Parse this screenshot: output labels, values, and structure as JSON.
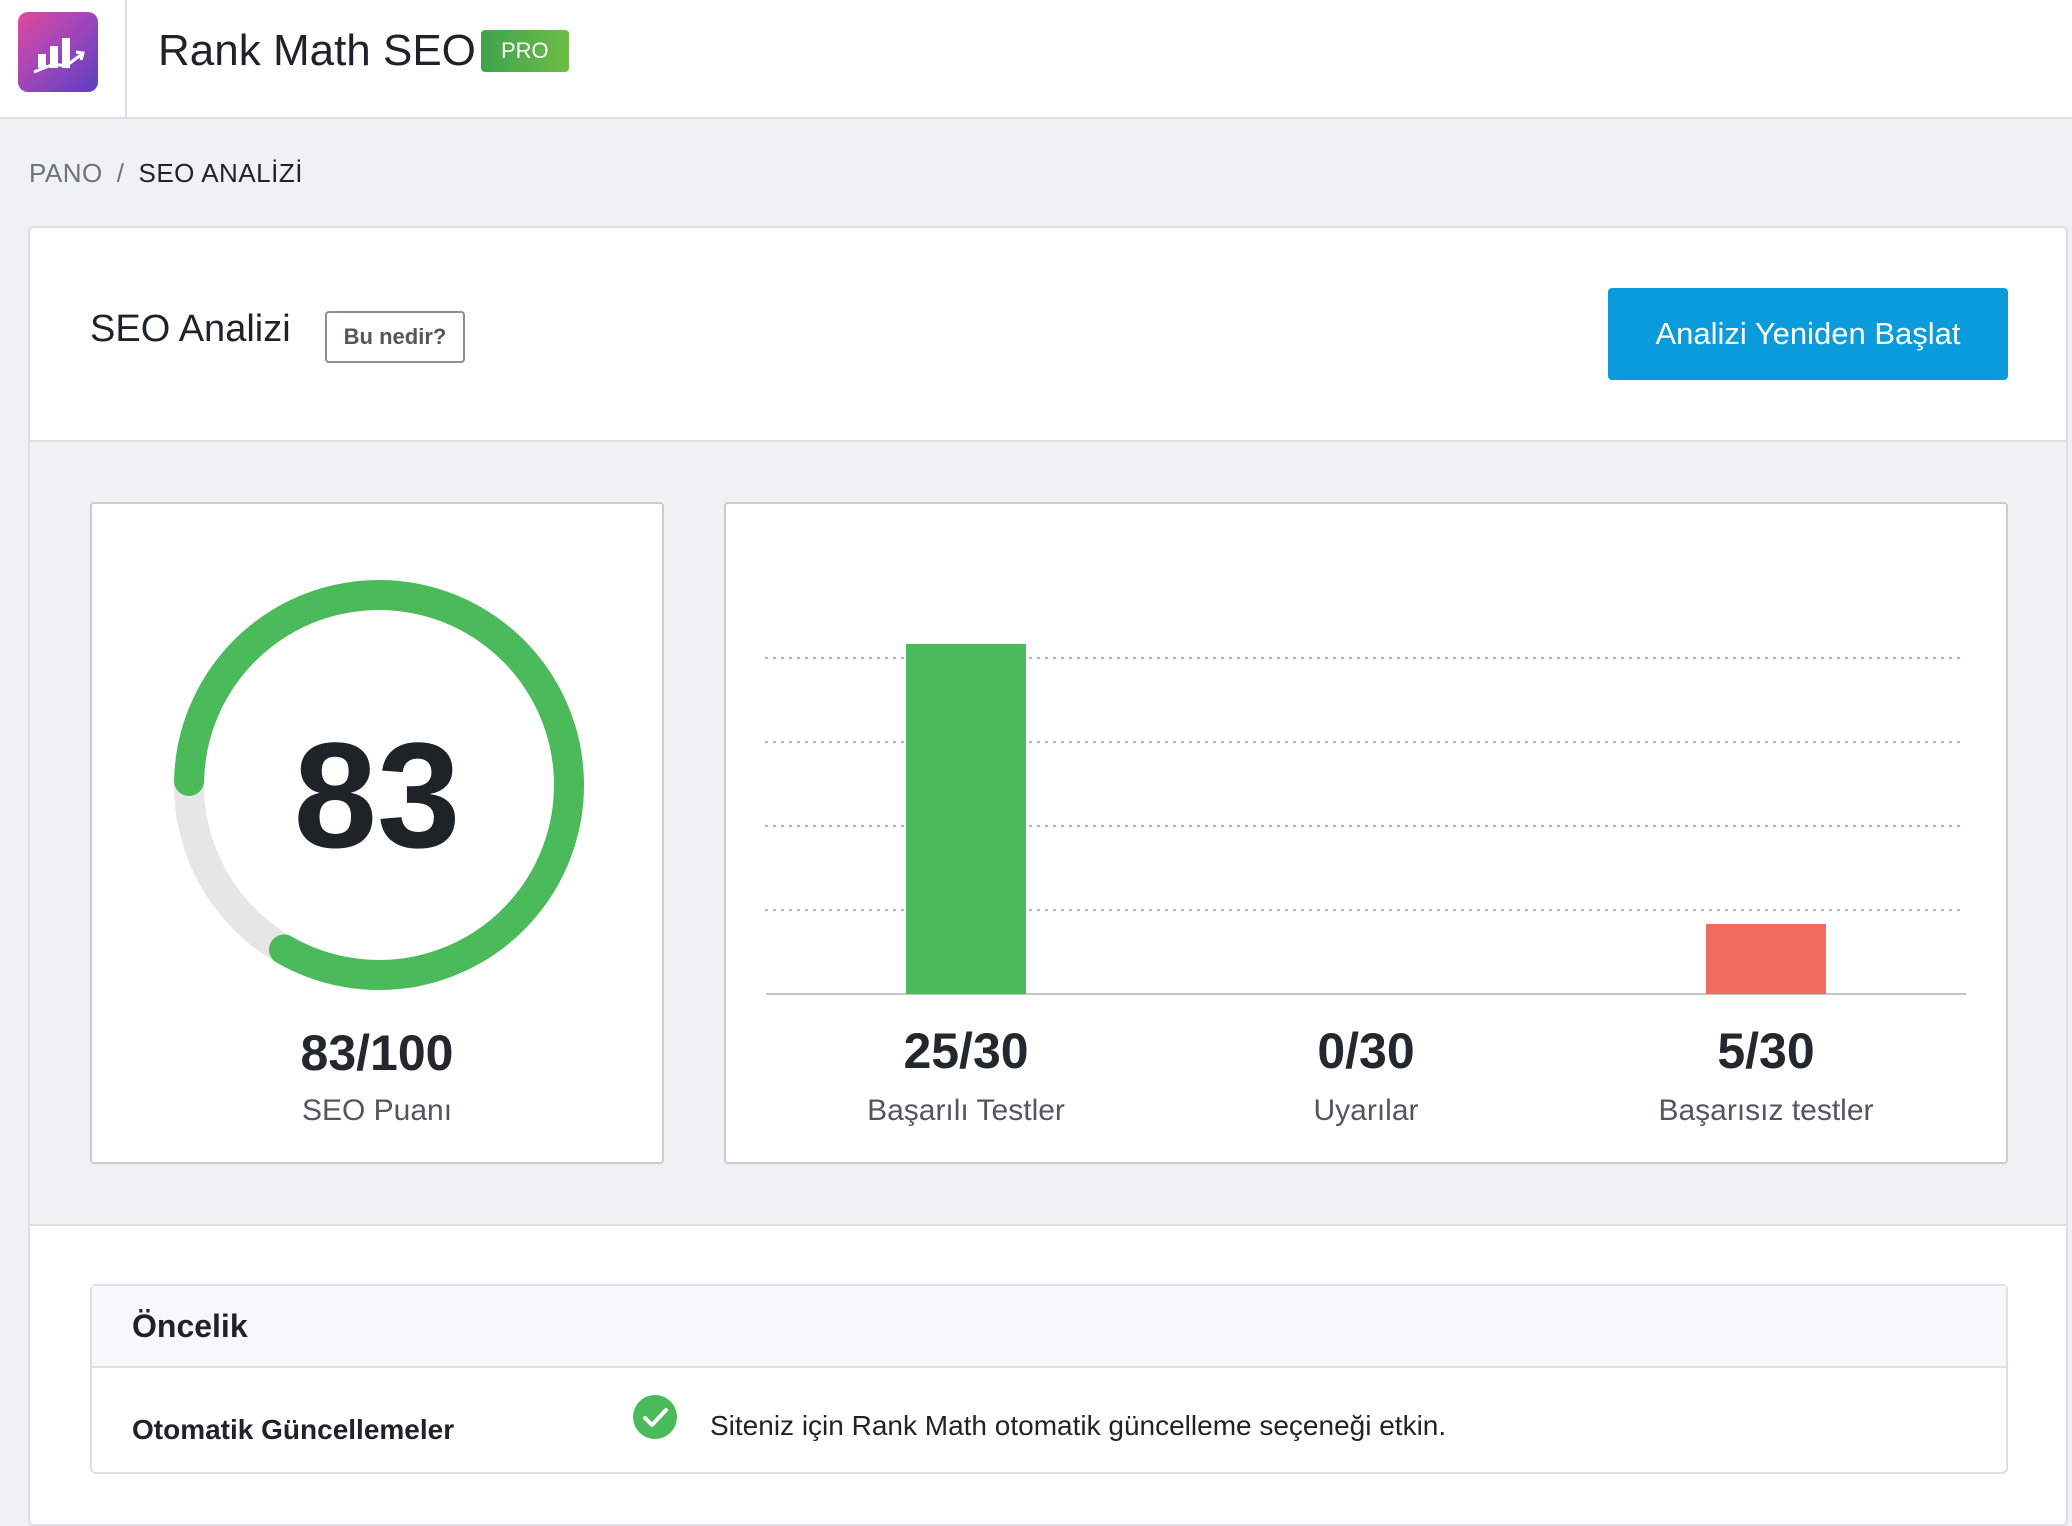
{
  "header": {
    "app_title": "Rank Math SEO",
    "badge": "PRO",
    "logo_icon": "rank-math-chart-icon"
  },
  "breadcrumb": {
    "items": [
      "PANO",
      "SEO ANALİZİ"
    ],
    "separator": "/"
  },
  "section": {
    "title": "SEO Analizi",
    "help_label": "Bu nedir?",
    "restart_label": "Analizi Yeniden Başlat"
  },
  "score": {
    "value": "83",
    "fraction": "83/100",
    "label": "SEO Puanı",
    "percent": 83,
    "color": "#4aba5a",
    "track_color": "#e6e6e6"
  },
  "chart_data": {
    "type": "bar",
    "categories": [
      "Başarılı Testler",
      "Uyarılar",
      "Başarısız testler"
    ],
    "values": [
      25,
      0,
      5
    ],
    "max": 30,
    "value_labels": [
      "25/30",
      "0/30",
      "5/30"
    ],
    "colors": [
      "#4aba5a",
      "#f0ad4e",
      "#f36b5f"
    ],
    "grid": "dotted horizontal"
  },
  "priority": {
    "title": "Öncelik",
    "rows": [
      {
        "label": "Otomatik Güncellemeler",
        "status_icon": "check-circle-icon",
        "text": "Siteniz için Rank Math otomatik güncelleme seçeneği etkin."
      }
    ]
  }
}
